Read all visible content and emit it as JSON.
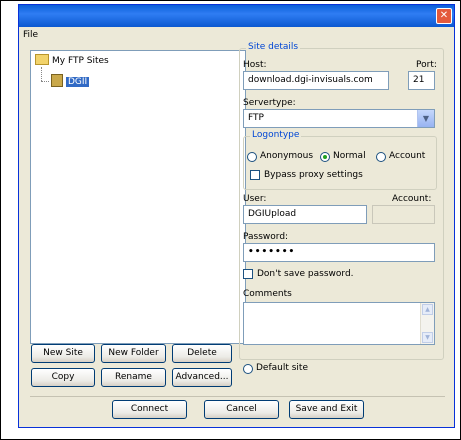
{
  "window": {
    "close_glyph": "✕"
  },
  "menu": {
    "file": "File"
  },
  "tree": {
    "root": "My FTP Sites",
    "child": "DGII"
  },
  "tree_buttons": {
    "new_site": "New Site",
    "new_folder": "New Folder",
    "delete": "Delete",
    "copy": "Copy",
    "rename": "Rename",
    "advanced": "Advanced..."
  },
  "site_details": {
    "title": "Site details",
    "host_label": "Host:",
    "host_value": "download.dgi-invisuals.com",
    "port_label": "Port:",
    "port_value": "21",
    "servertype_label": "Servertype:",
    "servertype_value": "FTP",
    "logontype": {
      "title": "Logontype",
      "anonymous": "Anonymous",
      "normal": "Normal",
      "account": "Account",
      "selected": "Normal",
      "bypass_proxy": "Bypass proxy settings"
    },
    "user_label": "User:",
    "user_value": "DGIUpload",
    "account_label": "Account:",
    "account_value": "",
    "password_label": "Password:",
    "password_value": "•••••••",
    "dont_save_password": "Don't save password.",
    "comments_label": "Comments",
    "comments_value": ""
  },
  "default_site": "Default site",
  "actions": {
    "connect": "Connect",
    "cancel": "Cancel",
    "save_exit": "Save and Exit"
  }
}
